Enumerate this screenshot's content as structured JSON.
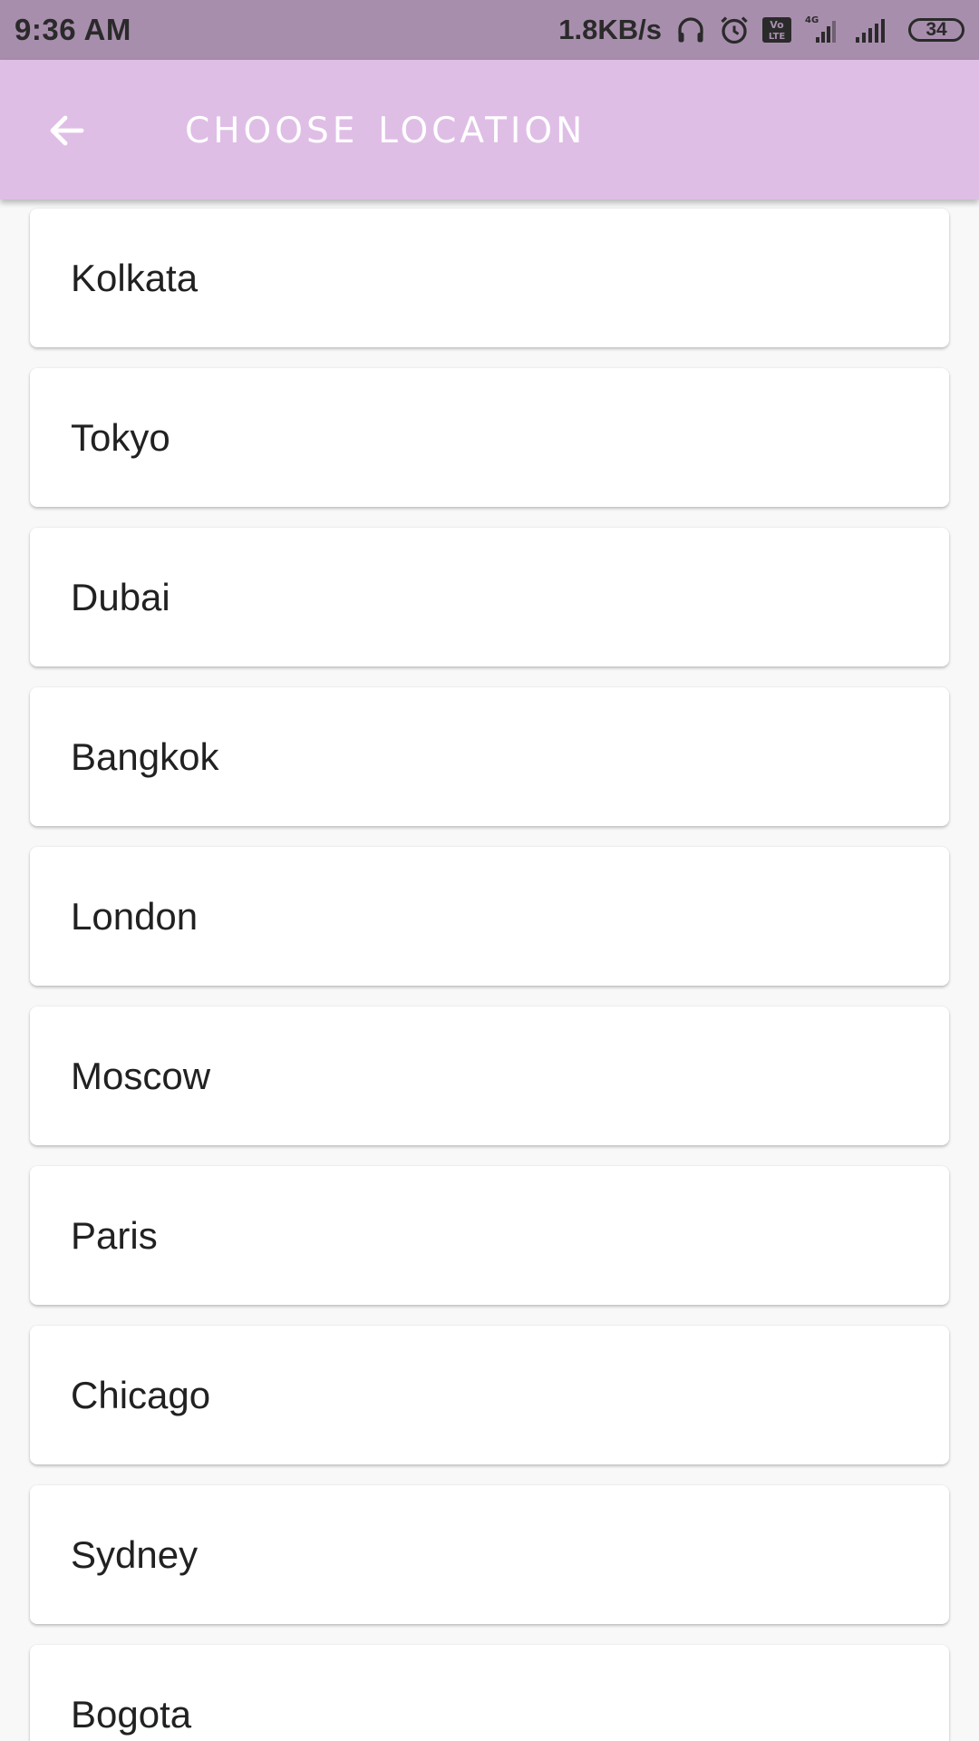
{
  "status_bar": {
    "time": "9:36 AM",
    "network_speed": "1.8KB/s",
    "network_type": "4G",
    "volte": "Vo LTE",
    "battery": "34",
    "icons": [
      "headphones-icon",
      "alarm-icon",
      "volte-icon",
      "signal-4g-icon",
      "signal-icon",
      "battery-icon"
    ]
  },
  "app_bar": {
    "title": "Choose Location",
    "back_icon": "arrow-left-icon",
    "background": "#dfbee6"
  },
  "locations": [
    {
      "label": "Kolkata"
    },
    {
      "label": "Tokyo"
    },
    {
      "label": "Dubai"
    },
    {
      "label": "Bangkok"
    },
    {
      "label": "London"
    },
    {
      "label": "Moscow"
    },
    {
      "label": "Paris"
    },
    {
      "label": "Chicago"
    },
    {
      "label": "Sydney"
    },
    {
      "label": "Bogota"
    }
  ]
}
